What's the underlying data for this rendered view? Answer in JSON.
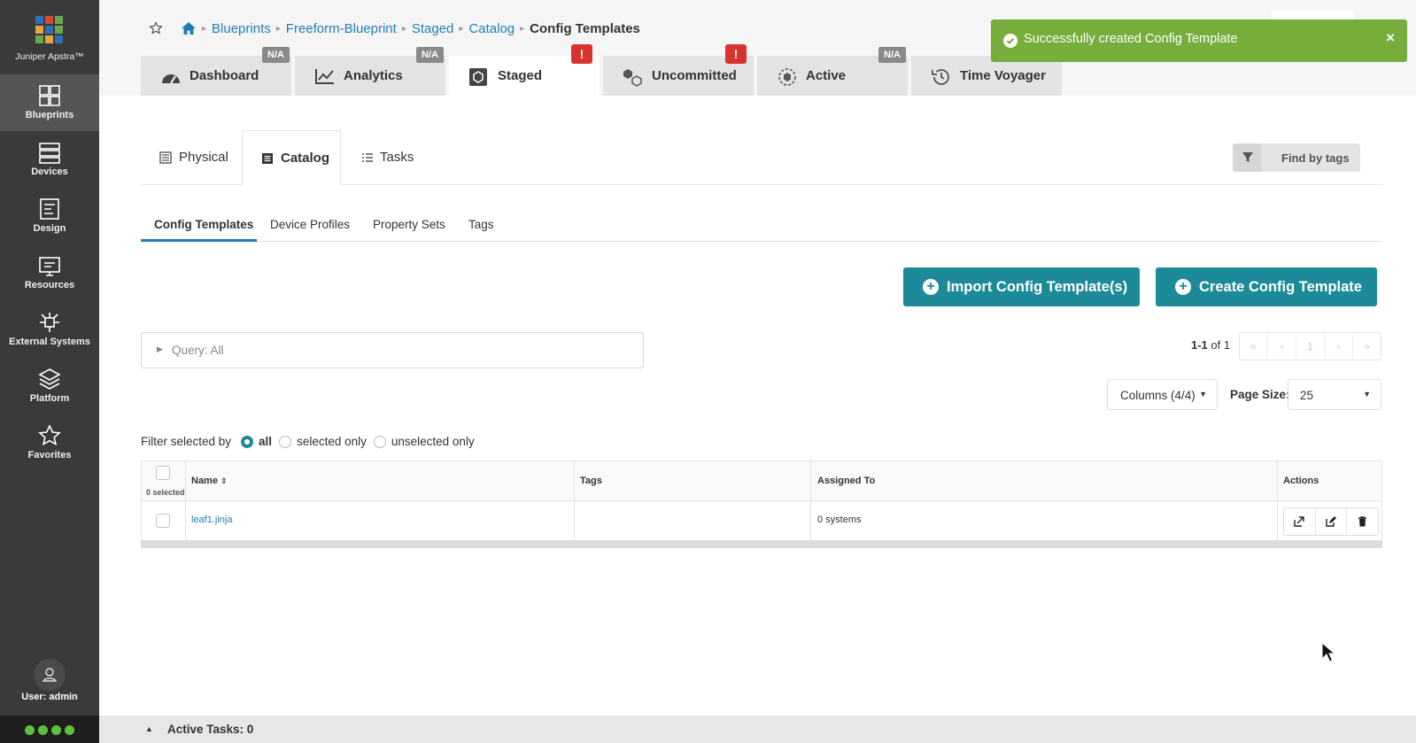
{
  "app": {
    "name": "Juniper Apstra™",
    "user_label": "User: admin"
  },
  "sidebar": {
    "items": [
      {
        "label": "Blueprints",
        "icon": "blueprints-icon"
      },
      {
        "label": "Devices",
        "icon": "devices-icon"
      },
      {
        "label": "Design",
        "icon": "design-icon"
      },
      {
        "label": "Resources",
        "icon": "resources-icon"
      },
      {
        "label": "External Systems",
        "icon": "external-systems-icon"
      },
      {
        "label": "Platform",
        "icon": "platform-icon"
      },
      {
        "label": "Favorites",
        "icon": "star-icon"
      }
    ]
  },
  "breadcrumb": {
    "items": [
      "Blueprints",
      "Freeform-Blueprint",
      "Staged",
      "Catalog"
    ],
    "current": "Config Templates"
  },
  "tabs": [
    {
      "label": "Dashboard",
      "badge": "N/A"
    },
    {
      "label": "Analytics",
      "badge": "N/A"
    },
    {
      "label": "Staged",
      "badge": "!"
    },
    {
      "label": "Uncommitted",
      "badge": "!"
    },
    {
      "label": "Active",
      "badge": "N/A"
    },
    {
      "label": "Time Voyager",
      "badge": ""
    }
  ],
  "toast": {
    "message": "Successfully created Config Template",
    "close": "×"
  },
  "subtabs": [
    "Physical",
    "Catalog",
    "Tasks"
  ],
  "find_tags_label": "Find by tags",
  "catalog_tabs": [
    "Config Templates",
    "Device Profiles",
    "Property Sets",
    "Tags"
  ],
  "buttons": {
    "import": "Import Config Template(s)",
    "create": "Create Config Template"
  },
  "query": {
    "label": "Query: All"
  },
  "pagination": {
    "range_bold": "1-1",
    "range_rest": " of 1",
    "controls": [
      "«",
      "‹",
      "1",
      "›",
      "»"
    ]
  },
  "columns_label": "Columns (4/4)",
  "page_size": {
    "label": "Page Size:",
    "value": "25"
  },
  "filter": {
    "label": "Filter selected by",
    "options": [
      "all",
      "selected only",
      "unselected only"
    ],
    "selected": "all"
  },
  "table": {
    "selected_count": "0 selected",
    "headers": [
      "Name",
      "Tags",
      "Assigned To",
      "Actions"
    ],
    "rows": [
      {
        "name": "leaf1.jinja",
        "tags": "",
        "assigned_to": "0 systems"
      }
    ]
  },
  "bottom_bar": {
    "label": "Active Tasks: 0"
  },
  "colors": {
    "sidebar": "#3a3a3a",
    "accent": "#1d8a99",
    "link": "#1f7fb5",
    "toast": "#77ad3b",
    "warn": "#d9332f",
    "status_dot": "#5fbf3f"
  }
}
